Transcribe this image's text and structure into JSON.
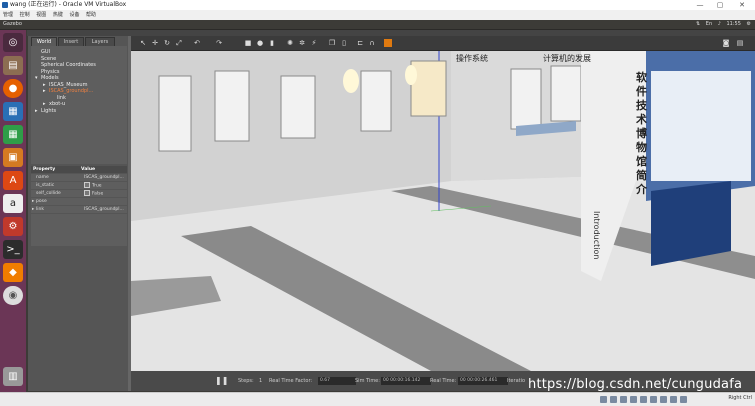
{
  "window": {
    "title": "wang (正在运行) - Oracle VM VirtualBox",
    "controls": [
      "—",
      "▢",
      "✕"
    ]
  },
  "vbox_menu": [
    "管理",
    "控制",
    "视图",
    "热键",
    "设备",
    "帮助"
  ],
  "top_panel": {
    "app_name": "Gazebo",
    "clock": "11:55"
  },
  "launcher": [
    {
      "icon": "ubuntu-dash-icon",
      "color": "#4a2a3e"
    },
    {
      "icon": "files-icon",
      "color": "#8c6d52"
    },
    {
      "icon": "firefox-icon",
      "color": "#e66000"
    },
    {
      "icon": "writer-icon",
      "color": "#2a6fb5"
    },
    {
      "icon": "calc-icon",
      "color": "#2f9d48"
    },
    {
      "icon": "impress-icon",
      "color": "#d57a22"
    },
    {
      "icon": "software-center-icon",
      "color": "#dd4814"
    },
    {
      "icon": "amazon-icon",
      "color": "#333333"
    },
    {
      "icon": "system-settings-icon",
      "color": "#c0392b"
    },
    {
      "icon": "terminal-icon",
      "color": "#2c2c2c"
    },
    {
      "icon": "virtualbox-icon",
      "color": "#f07d00"
    },
    {
      "icon": "dvd-icon",
      "color": "#cccccc"
    },
    {
      "icon": "trash-icon",
      "color": "#999999"
    }
  ],
  "panel_tabs": [
    "World",
    "Insert",
    "Layers"
  ],
  "world_tree": {
    "items": [
      {
        "label": "GUI",
        "indent": 1,
        "arrow": ""
      },
      {
        "label": "Scene",
        "indent": 1,
        "arrow": ""
      },
      {
        "label": "Spherical Coordinates",
        "indent": 1,
        "arrow": ""
      },
      {
        "label": "Physics",
        "indent": 1,
        "arrow": ""
      },
      {
        "label": "Models",
        "indent": 0,
        "arrow": "▾"
      },
      {
        "label": "ISCAS_Museum",
        "indent": 1,
        "arrow": "▸"
      },
      {
        "label": "ISCAS_groundpl...",
        "indent": 1,
        "arrow": "▸",
        "selected": true
      },
      {
        "label": "link",
        "indent": 2,
        "arrow": ""
      },
      {
        "label": "xbot-u",
        "indent": 1,
        "arrow": "▸"
      },
      {
        "label": "Lights",
        "indent": 0,
        "arrow": "▸"
      }
    ]
  },
  "properties": {
    "headers": [
      "Property",
      "Value"
    ],
    "rows": [
      {
        "key": "name",
        "value": "ISCAS_groundpl..."
      },
      {
        "key": "is_static",
        "value": "True",
        "check": true
      },
      {
        "key": "self_collide",
        "value": "False",
        "check": true
      },
      {
        "key": "pose",
        "value": "",
        "arrow": "▸"
      },
      {
        "key": "link",
        "value": "ISCAS_groundpl...",
        "arrow": "▸"
      }
    ]
  },
  "toolbar": [
    "select",
    "translate",
    "rotate",
    "scale",
    "undo",
    "redo",
    "box",
    "sphere",
    "cylinder",
    "point-light",
    "spot-light",
    "dir-light",
    "copy",
    "paste",
    "align",
    "snap",
    "record",
    "screenshot"
  ],
  "scene": {
    "sign_text": "软件技术博物馆简介",
    "sign_intro": "Introduction",
    "wall_text_1": "操作系统",
    "wall_text_2": "计算机的发展"
  },
  "bottom": {
    "steps_label": "Steps:",
    "steps_value": "1",
    "rtf_label": "Real Time Factor:",
    "rtf_value": "0.67",
    "sim_label": "Sim Time:",
    "sim_value": "00 00:00:16.142",
    "real_label": "Real Time:",
    "real_value": "00 00:00:26.461",
    "iter_label": "Iteratio"
  },
  "watermark": "https://blog.csdn.net/cungudafa",
  "status": {
    "host_key": "Right Ctrl"
  }
}
